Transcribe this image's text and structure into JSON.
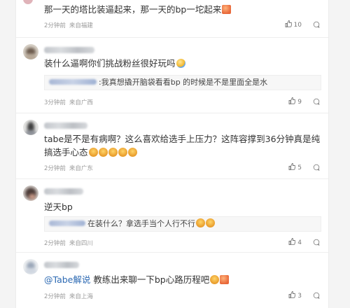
{
  "comments": [
    {
      "text": "那一天的塔比装逼起来，那一天的bp一坨起来",
      "time": "2分钟前",
      "location": "来自福建",
      "likes": "10"
    },
    {
      "text": "装什么逼啊你们挑战粉丝很好玩吗",
      "time": "3分钟前",
      "location": "来自广西",
      "likes": "9",
      "reply": "我真想撬开脑袋看看bp 的时候是不是里面全是水"
    },
    {
      "text": "tabe是不是有病啊？这么喜欢给选手上压力？这阵容撑到36分钟真是纯搞选手心态",
      "time": "2分钟前",
      "location": "来自广东",
      "likes": "5"
    },
    {
      "text": "逆天bp",
      "time": "2分钟前",
      "location": "来自四川",
      "likes": "4",
      "reply": "在装什么？拿选手当个人行不行"
    },
    {
      "mention": "@Tabe解说",
      "text": " 教练出来聊一下bp心路历程吧",
      "time": "2分钟前",
      "location": "来自上海",
      "likes": "3"
    }
  ],
  "colors": {
    "card_bg": "#ffffff",
    "page_bg": "#f4f4f4",
    "mention": "#2d6ab3",
    "meta_text": "#9a9a9a"
  },
  "icons": [
    "thumb-up-icon",
    "comment-bubble-icon",
    "emoji-icon"
  ]
}
